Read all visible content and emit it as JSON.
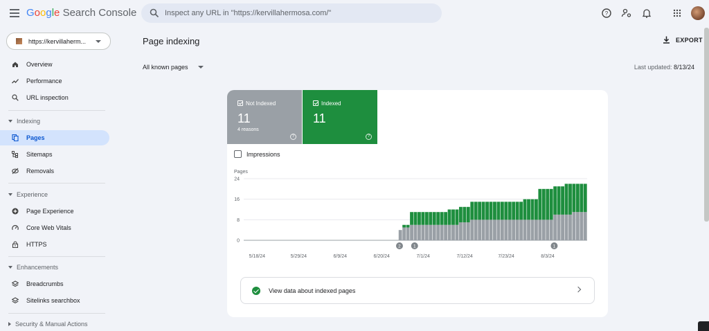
{
  "app": {
    "logo_google": "Google",
    "logo_product": "Search Console"
  },
  "search": {
    "placeholder": "Inspect any URL in \"https://kervillahermosa.com/\""
  },
  "property": {
    "name": "https://kervillaherm..."
  },
  "sidebar": {
    "items": [
      {
        "label": "Overview",
        "icon": "home-icon"
      },
      {
        "label": "Performance",
        "icon": "trending-icon"
      },
      {
        "label": "URL inspection",
        "icon": "search-icon"
      }
    ],
    "sections": [
      {
        "label": "Indexing",
        "items": [
          {
            "label": "Pages",
            "icon": "pages-icon",
            "active": true
          },
          {
            "label": "Sitemaps",
            "icon": "sitemap-icon"
          },
          {
            "label": "Removals",
            "icon": "removals-icon"
          }
        ]
      },
      {
        "label": "Experience",
        "items": [
          {
            "label": "Page Experience",
            "icon": "plus-circle-icon"
          },
          {
            "label": "Core Web Vitals",
            "icon": "gauge-icon"
          },
          {
            "label": "HTTPS",
            "icon": "lock-icon"
          }
        ]
      },
      {
        "label": "Enhancements",
        "items": [
          {
            "label": "Breadcrumbs",
            "icon": "layers-icon"
          },
          {
            "label": "Sitelinks searchbox",
            "icon": "layers-icon"
          }
        ]
      },
      {
        "label": "Security & Manual Actions",
        "items": []
      }
    ]
  },
  "main": {
    "title": "Page indexing",
    "export_label": "EXPORT",
    "filter_label": "All known pages",
    "last_updated_label": "Last updated:",
    "last_updated_value": "8/13/24"
  },
  "tiles": {
    "not_indexed": {
      "label": "Not Indexed",
      "count": "11",
      "sub": "4 reasons",
      "help": "?"
    },
    "indexed": {
      "label": "Indexed",
      "count": "11",
      "help": "?"
    }
  },
  "impressions_label": "Impressions",
  "view_data_label": "View data about indexed pages",
  "colors": {
    "not_indexed": "#9aa0a6",
    "indexed": "#1e8e3e",
    "accent": "#0b57d0"
  },
  "chart_data": {
    "type": "bar",
    "stacked": true,
    "ylabel": "Pages",
    "ylim": [
      0,
      24
    ],
    "yticks": [
      0,
      8,
      16,
      24
    ],
    "x_start": "5/15/24",
    "x_end": "8/13/24",
    "xticks": [
      "5/18/24",
      "5/29/24",
      "6/9/24",
      "6/20/24",
      "7/1/24",
      "7/12/24",
      "7/23/24",
      "8/3/24"
    ],
    "segments": [
      {
        "from": "6/25/24",
        "to": "6/25/24",
        "not_indexed": 4,
        "indexed": 0
      },
      {
        "from": "6/26/24",
        "to": "6/27/24",
        "not_indexed": 5,
        "indexed": 1
      },
      {
        "from": "6/28/24",
        "to": "7/7/24",
        "not_indexed": 6,
        "indexed": 5
      },
      {
        "from": "7/8/24",
        "to": "7/10/24",
        "not_indexed": 6,
        "indexed": 6
      },
      {
        "from": "7/11/24",
        "to": "7/13/24",
        "not_indexed": 7,
        "indexed": 6
      },
      {
        "from": "7/14/24",
        "to": "7/27/24",
        "not_indexed": 8,
        "indexed": 7
      },
      {
        "from": "7/28/24",
        "to": "7/31/24",
        "not_indexed": 8,
        "indexed": 8
      },
      {
        "from": "8/1/24",
        "to": "8/4/24",
        "not_indexed": 8,
        "indexed": 12
      },
      {
        "from": "8/5/24",
        "to": "8/7/24",
        "not_indexed": 10,
        "indexed": 11
      },
      {
        "from": "8/8/24",
        "to": "8/9/24",
        "not_indexed": 10,
        "indexed": 12
      },
      {
        "from": "8/10/24",
        "to": "8/13/24",
        "not_indexed": 11,
        "indexed": 11
      }
    ],
    "annotations": [
      {
        "date": "6/25/24",
        "label": "2"
      },
      {
        "date": "6/29/24",
        "label": "1"
      },
      {
        "date": "8/5/24",
        "label": "1"
      }
    ]
  }
}
